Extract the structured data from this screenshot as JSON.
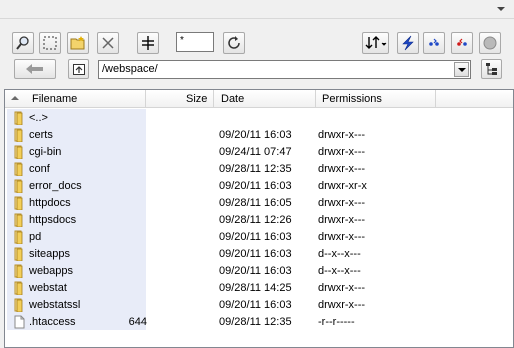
{
  "toolbar": {
    "filter_value": "*"
  },
  "path": {
    "value": "/webspace/"
  },
  "columns": {
    "filename": "Filename",
    "size": "Size",
    "date": "Date",
    "permissions": "Permissions"
  },
  "rows": [
    {
      "name": "<..>",
      "size": "",
      "date": "",
      "perms": "",
      "icon": "folder-icon"
    },
    {
      "name": "certs",
      "size": "",
      "date": "09/20/11  16:03",
      "perms": "drwxr-x---",
      "icon": "folder-icon"
    },
    {
      "name": "cgi-bin",
      "size": "",
      "date": "09/24/11  07:47",
      "perms": "drwxr-x---",
      "icon": "folder-icon"
    },
    {
      "name": "conf",
      "size": "",
      "date": "09/28/11  12:35",
      "perms": "drwxr-x---",
      "icon": "folder-icon"
    },
    {
      "name": "error_docs",
      "size": "",
      "date": "09/20/11  16:03",
      "perms": "drwxr-xr-x",
      "icon": "folder-icon"
    },
    {
      "name": "httpdocs",
      "size": "",
      "date": "09/28/11  16:05",
      "perms": "drwxr-x---",
      "icon": "folder-icon"
    },
    {
      "name": "httpsdocs",
      "size": "",
      "date": "09/28/11  12:26",
      "perms": "drwxr-x---",
      "icon": "folder-icon"
    },
    {
      "name": "pd",
      "size": "",
      "date": "09/20/11  16:03",
      "perms": "drwxr-x---",
      "icon": "folder-icon"
    },
    {
      "name": "siteapps",
      "size": "",
      "date": "09/20/11  16:03",
      "perms": "d--x--x---",
      "icon": "folder-icon"
    },
    {
      "name": "webapps",
      "size": "",
      "date": "09/20/11  16:03",
      "perms": "d--x--x---",
      "icon": "folder-icon"
    },
    {
      "name": "webstat",
      "size": "",
      "date": "09/28/11  14:25",
      "perms": "drwxr-x---",
      "icon": "folder-icon"
    },
    {
      "name": "webstatssl",
      "size": "",
      "date": "09/20/11  16:03",
      "perms": "drwxr-x---",
      "icon": "folder-icon"
    },
    {
      "name": ".htaccess",
      "size": "644",
      "date": "09/28/11  12:35",
      "perms": "-r--r-----",
      "icon": "file-icon"
    }
  ]
}
